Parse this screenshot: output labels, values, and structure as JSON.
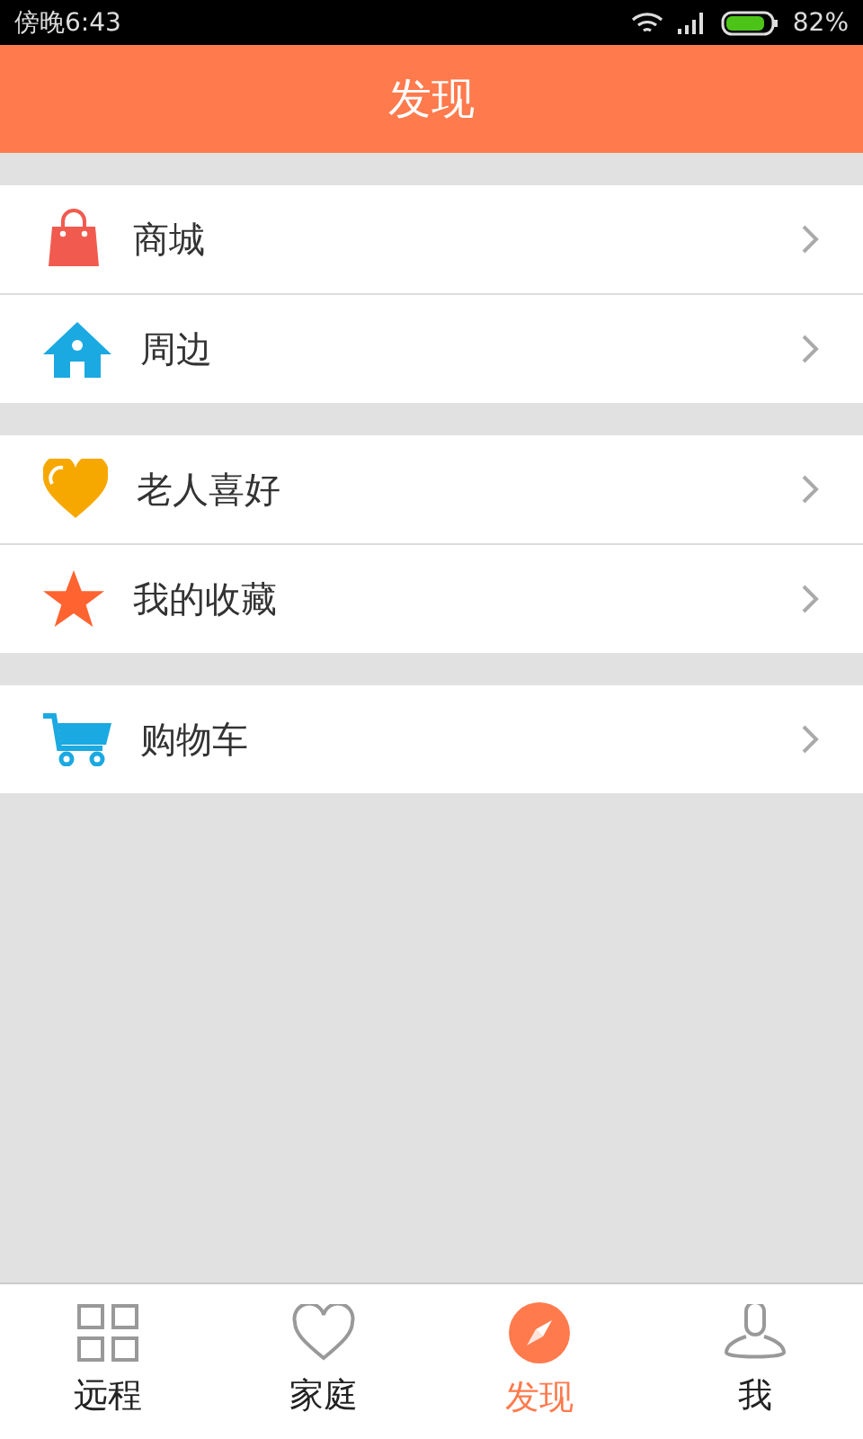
{
  "status_bar": {
    "time": "傍晚6:43",
    "battery_text": "82%"
  },
  "header": {
    "title": "发现"
  },
  "groups": [
    {
      "items": [
        {
          "kind": "bag",
          "label": "商城"
        },
        {
          "kind": "house",
          "label": "周边"
        }
      ]
    },
    {
      "items": [
        {
          "kind": "heart",
          "label": "老人喜好"
        },
        {
          "kind": "star",
          "label": "我的收藏"
        }
      ]
    },
    {
      "items": [
        {
          "kind": "cart",
          "label": "购物车"
        }
      ]
    }
  ],
  "tab_bar": [
    {
      "kind": "grid",
      "label": "远程",
      "selected": false
    },
    {
      "kind": "heart",
      "label": "家庭",
      "selected": false
    },
    {
      "kind": "compass",
      "label": "发现",
      "selected": true
    },
    {
      "kind": "person",
      "label": "我",
      "selected": false
    }
  ]
}
